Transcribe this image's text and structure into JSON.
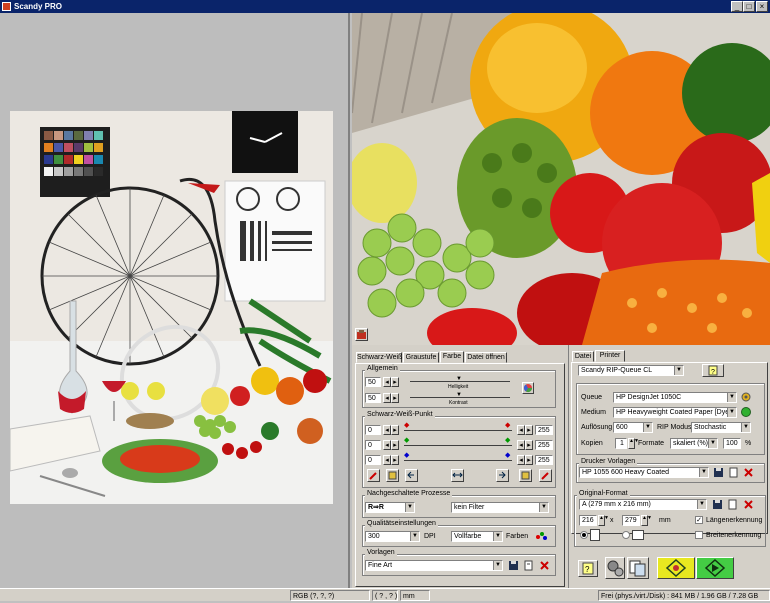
{
  "window": {
    "title": "Scandy PRO",
    "min": "_",
    "max": "□",
    "close": "×"
  },
  "left_tabs": [
    "Schwarz-Weiß",
    "Graustufe",
    "Farbe",
    "Datei öffnen"
  ],
  "right_tabs": [
    "Datei",
    "Printer"
  ],
  "allgemein": {
    "label": "Allgemein",
    "brightness": "50",
    "contrast": "50",
    "brightness_label": "Helligkeit",
    "contrast_label": "Kontrast"
  },
  "swpunkt": {
    "label": "Schwarz-Weiß-Punkt",
    "rows": [
      {
        "left": "0",
        "right": "255"
      },
      {
        "left": "0",
        "right": "255"
      },
      {
        "left": "0",
        "right": "255"
      }
    ]
  },
  "nach": {
    "label": "Nachgeschaltete Prozesse",
    "process": "R⇒R",
    "filter": "kein Filter"
  },
  "quality": {
    "label": "Qualitätseinstellungen",
    "dpi_value": "300",
    "dpi_unit": "DPI",
    "mode": "Vollfarbe",
    "farben": "Farben"
  },
  "vorlagen": {
    "label": "Vorlagen",
    "value": "Fine Art"
  },
  "printer": {
    "rip_queue": "Scandy RIP-Queue CL",
    "queue_label": "Queue",
    "queue": "HP DesignJet 1050C",
    "medium_label": "Medium",
    "medium": "HP Heavyweight Coated Paper [Dye]",
    "res_label": "Auflösung",
    "res": "600",
    "rip_label": "RIP Modus",
    "rip": "Stochastic",
    "copies_label": "Kopien",
    "copies": "1",
    "formats_label": "Formate",
    "scaled": "skaliert (%)",
    "pct": "100",
    "pct_unit": "%"
  },
  "drucker": {
    "label": "Drucker Vorlagen",
    "value": "HP 1055 600 Heavy Coated"
  },
  "orig": {
    "label": "Original-Format",
    "format": "A (279 mm x 216 mm)",
    "w": "216",
    "x": "x",
    "h": "279",
    "unit": "mm",
    "laengen": "Längenerkennung",
    "breiten": "Breitenerkennung"
  },
  "status": {
    "mode": "RGB (?, ?, ?)",
    "coords": "( ? , ? )",
    "unit": "mm",
    "free": "Frei (phys./virt./Disk) : 841 MB / 1.96 GB / 7.28 GB"
  },
  "colors": {
    "title_bar": "#0a246a",
    "panel": "#d4d0c8",
    "go_green": "#44cc44",
    "go_yellow": "#e8e820"
  }
}
